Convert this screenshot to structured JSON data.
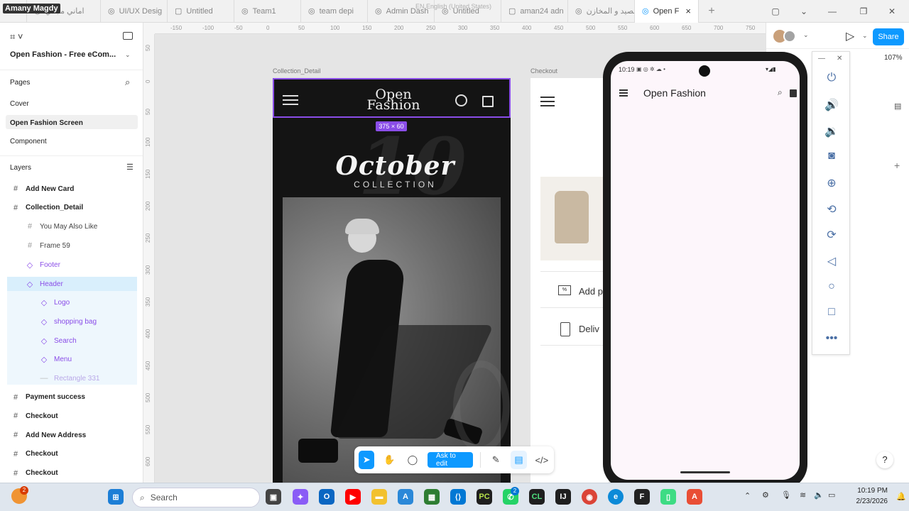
{
  "browser": {
    "user_badge": "Amany Magdy",
    "tabs": [
      {
        "label": "اماني مجدي",
        "icon": "figma-icon"
      },
      {
        "label": "UI/UX Desig",
        "icon": "figma-icon"
      },
      {
        "label": "Untitled",
        "icon": "doc-icon"
      },
      {
        "label": "Team1",
        "icon": "figma-icon"
      },
      {
        "label": "team depi",
        "icon": "figma-icon"
      },
      {
        "label": "Admin Dash",
        "icon": "figma-icon"
      },
      {
        "label": "Untitled",
        "icon": "figma-icon"
      },
      {
        "label": "aman24 adn",
        "icon": "doc-icon"
      },
      {
        "label": "م الصيد و المخازن",
        "icon": "figma-icon"
      },
      {
        "label": "Open F",
        "icon": "figma-icon"
      }
    ],
    "overlay_text": "EN English (United States)",
    "add_tab": "+"
  },
  "figma": {
    "file_name": "Open Fashion - Free eCom...",
    "pages_title": "Pages",
    "pages": [
      "Cover",
      "Open Fashion Screen",
      "Component"
    ],
    "layers_title": "Layers",
    "layers": [
      {
        "label": "Add New Card",
        "icon": "#",
        "indent": 0,
        "style": "frame"
      },
      {
        "label": "Collection_Detail",
        "icon": "#",
        "indent": 0,
        "style": "frame"
      },
      {
        "label": "You May Also Like",
        "icon": "#",
        "indent": 1,
        "style": "frame"
      },
      {
        "label": "Frame 59",
        "icon": "#",
        "indent": 1,
        "style": "frame"
      },
      {
        "label": "Footer",
        "icon": "◇",
        "indent": 1,
        "style": "component"
      },
      {
        "label": "Header",
        "icon": "◇",
        "indent": 1,
        "style": "component-selected"
      },
      {
        "label": "Logo",
        "icon": "◇",
        "indent": 2,
        "style": "component-child"
      },
      {
        "label": "shopping bag",
        "icon": "◇",
        "indent": 2,
        "style": "component-child"
      },
      {
        "label": "Search",
        "icon": "◇",
        "indent": 2,
        "style": "component-child"
      },
      {
        "label": "Menu",
        "icon": "◇",
        "indent": 2,
        "style": "component-child"
      },
      {
        "label": "Rectangle 331",
        "icon": "—",
        "indent": 2,
        "style": "muted-child"
      },
      {
        "label": "Payment success",
        "icon": "#",
        "indent": 0,
        "style": "frame"
      },
      {
        "label": "Checkout",
        "icon": "#",
        "indent": 0,
        "style": "frame"
      },
      {
        "label": "Add New Address",
        "icon": "#",
        "indent": 0,
        "style": "frame"
      },
      {
        "label": "Checkout",
        "icon": "#",
        "indent": 0,
        "style": "frame"
      },
      {
        "label": "Checkout",
        "icon": "#",
        "indent": 0,
        "style": "frame"
      }
    ],
    "ruler_h": [
      "-150",
      "-100",
      "-50",
      "0",
      "50",
      "100",
      "150",
      "200",
      "250",
      "300",
      "350",
      "400",
      "450",
      "500",
      "550",
      "600",
      "650",
      "700",
      "750"
    ],
    "ruler_v": [
      "50",
      "0",
      "50",
      "100",
      "150",
      "200",
      "250",
      "300",
      "350",
      "400",
      "450",
      "500",
      "550",
      "600"
    ],
    "frame1_label": "Collection_Detail",
    "frame2_label": "Checkout",
    "size_tag": "375 × 60",
    "design": {
      "logo_line1": "Open",
      "logo_line2": "Fashion",
      "hero_title": "October",
      "hero_sub": "COLLECTION",
      "bg_number": "10"
    },
    "checkout": {
      "add_label": "Add p",
      "delivery_label": "Deliv"
    },
    "toolbar": {
      "ask_label": "Ask to edit"
    },
    "zoom": "107%",
    "share_label": "Share"
  },
  "emulator": {
    "status_time": "10:19",
    "app_title": "Open Fashion"
  },
  "taskbar": {
    "search_placeholder": "Search",
    "time": "10:19 PM",
    "date": "2/23/2026",
    "notification_badge": "2",
    "whatsapp_badge": "2",
    "help": "?"
  },
  "colors": {
    "accent": "#0d99ff",
    "selection": "#8a4de8"
  }
}
